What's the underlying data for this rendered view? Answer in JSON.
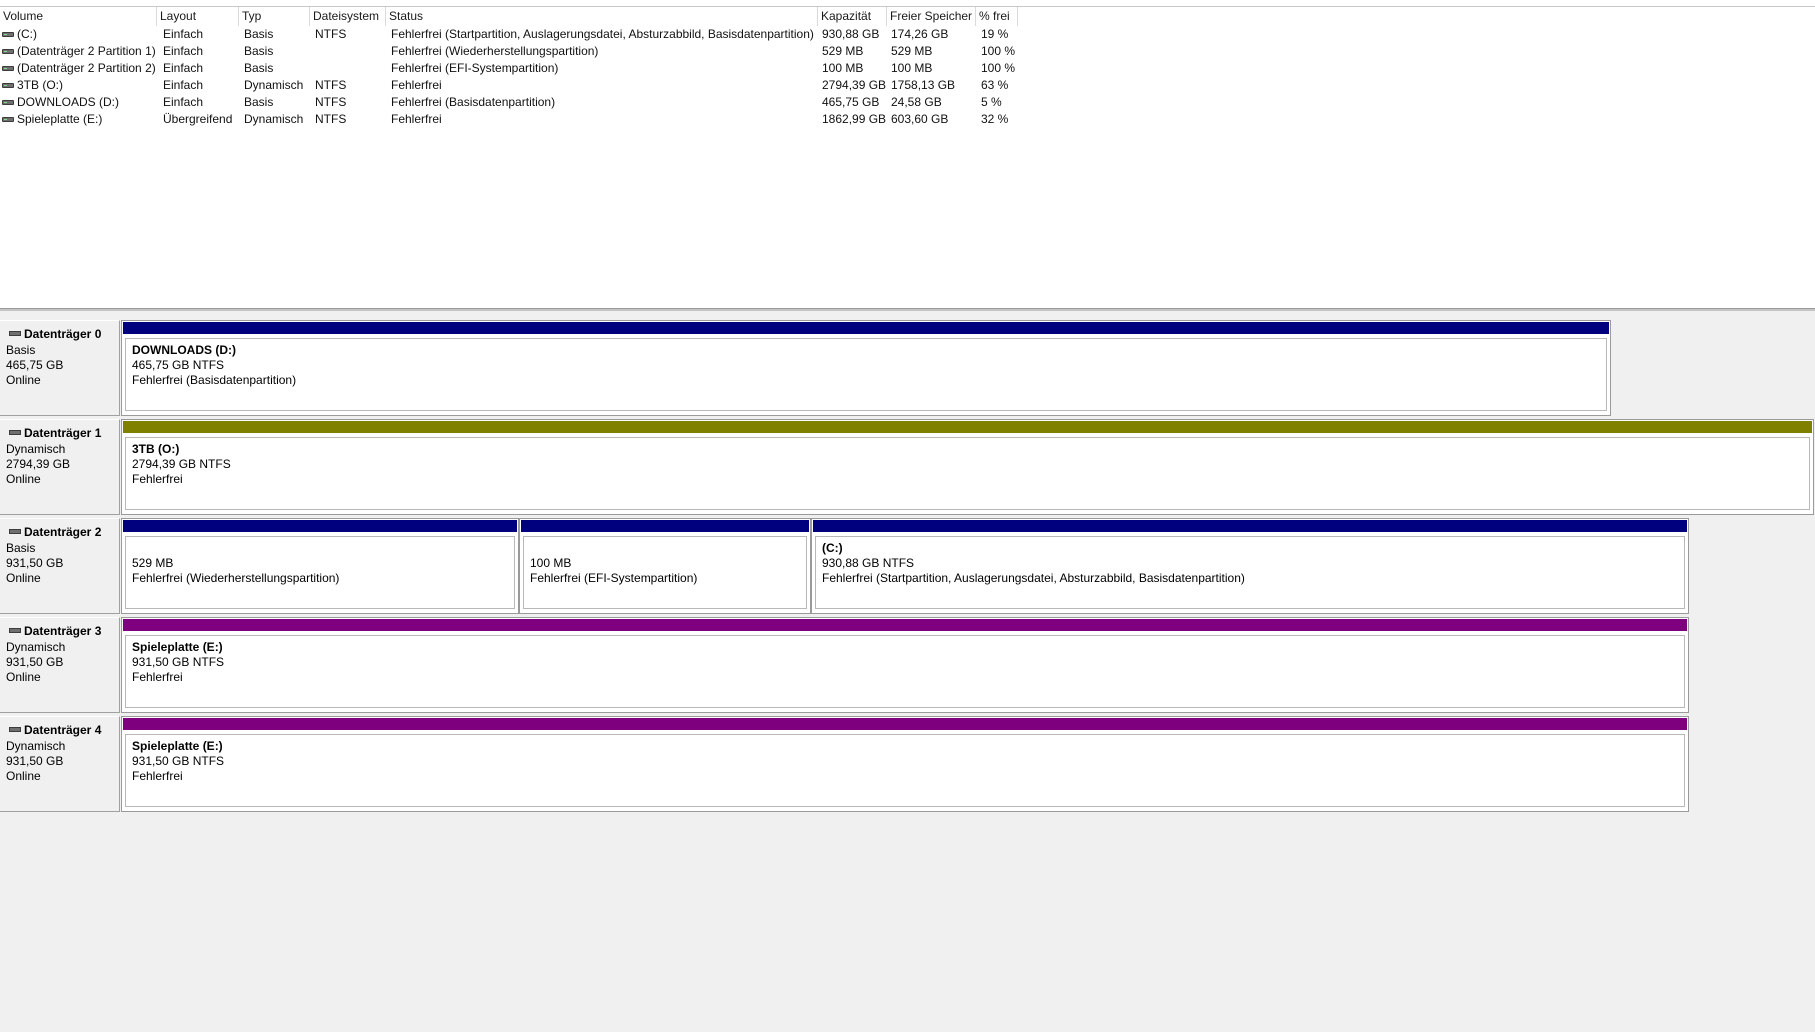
{
  "columns": [
    "Volume",
    "Layout",
    "Typ",
    "Dateisystem",
    "Status",
    "Kapazität",
    "Freier Speicher",
    "% frei"
  ],
  "volumes": [
    {
      "volume": " (C:)",
      "layout": "Einfach",
      "typ": "Basis",
      "fs": "NTFS",
      "status": "Fehlerfrei (Startpartition, Auslagerungsdatei, Absturzabbild, Basisdatenpartition)",
      "capacity": "930,88 GB",
      "free": "174,26 GB",
      "pct": "19 %"
    },
    {
      "volume": "(Datenträger 2 Partition 1)",
      "layout": "Einfach",
      "typ": "Basis",
      "fs": "",
      "status": "Fehlerfrei (Wiederherstellungspartition)",
      "capacity": "529 MB",
      "free": "529 MB",
      "pct": "100 %"
    },
    {
      "volume": "(Datenträger 2 Partition 2)",
      "layout": "Einfach",
      "typ": "Basis",
      "fs": "",
      "status": "Fehlerfrei (EFI-Systempartition)",
      "capacity": "100 MB",
      "free": "100 MB",
      "pct": "100 %"
    },
    {
      "volume": "3TB (O:)",
      "layout": "Einfach",
      "typ": "Dynamisch",
      "fs": "NTFS",
      "status": "Fehlerfrei",
      "capacity": "2794,39 GB",
      "free": "1758,13 GB",
      "pct": "63 %"
    },
    {
      "volume": "DOWNLOADS (D:)",
      "layout": "Einfach",
      "typ": "Basis",
      "fs": "NTFS",
      "status": "Fehlerfrei (Basisdatenpartition)",
      "capacity": "465,75 GB",
      "free": "24,58 GB",
      "pct": "5 %"
    },
    {
      "volume": "Spieleplatte (E:)",
      "layout": "Übergreifend",
      "typ": "Dynamisch",
      "fs": "NTFS",
      "status": "Fehlerfrei",
      "capacity": "1862,99 GB",
      "free": "603,60 GB",
      "pct": "32 %"
    }
  ],
  "colors": {
    "basic_partition": "#00007f",
    "simple_volume": "#7f7f00",
    "spanned_volume": "#7f007f"
  },
  "disks": [
    {
      "name": "Datenträger 0",
      "type": "Basis",
      "size": "465,75 GB",
      "state": "Online",
      "partitions": [
        {
          "title": "DOWNLOADS  (D:)",
          "size": "465,75 GB NTFS",
          "status": "Fehlerfrei (Basisdatenpartition)",
          "color": "#00007f"
        }
      ]
    },
    {
      "name": "Datenträger 1",
      "type": "Dynamisch",
      "size": "2794,39 GB",
      "state": "Online",
      "partitions": [
        {
          "title": "3TB  (O:)",
          "size": "2794,39 GB NTFS",
          "status": "Fehlerfrei",
          "color": "#7f7f00"
        }
      ]
    },
    {
      "name": "Datenträger 2",
      "type": "Basis",
      "size": "931,50 GB",
      "state": "Online",
      "partitions": [
        {
          "title": "",
          "size": "529 MB",
          "status": "Fehlerfrei (Wiederherstellungspartition)",
          "color": "#00007f"
        },
        {
          "title": "",
          "size": "100 MB",
          "status": "Fehlerfrei (EFI-Systempartition)",
          "color": "#00007f"
        },
        {
          "title": " (C:)",
          "size": "930,88 GB NTFS",
          "status": "Fehlerfrei (Startpartition, Auslagerungsdatei, Absturzabbild, Basisdatenpartition)",
          "color": "#00007f"
        }
      ]
    },
    {
      "name": "Datenträger 3",
      "type": "Dynamisch",
      "size": "931,50 GB",
      "state": "Online",
      "partitions": [
        {
          "title": "Spieleplatte  (E:)",
          "size": "931,50 GB NTFS",
          "status": "Fehlerfrei",
          "color": "#7f007f"
        }
      ]
    },
    {
      "name": "Datenträger 4",
      "type": "Dynamisch",
      "size": "931,50 GB",
      "state": "Online",
      "partitions": [
        {
          "title": "Spieleplatte  (E:)",
          "size": "931,50 GB NTFS",
          "status": "Fehlerfrei",
          "color": "#7f007f"
        }
      ]
    }
  ]
}
